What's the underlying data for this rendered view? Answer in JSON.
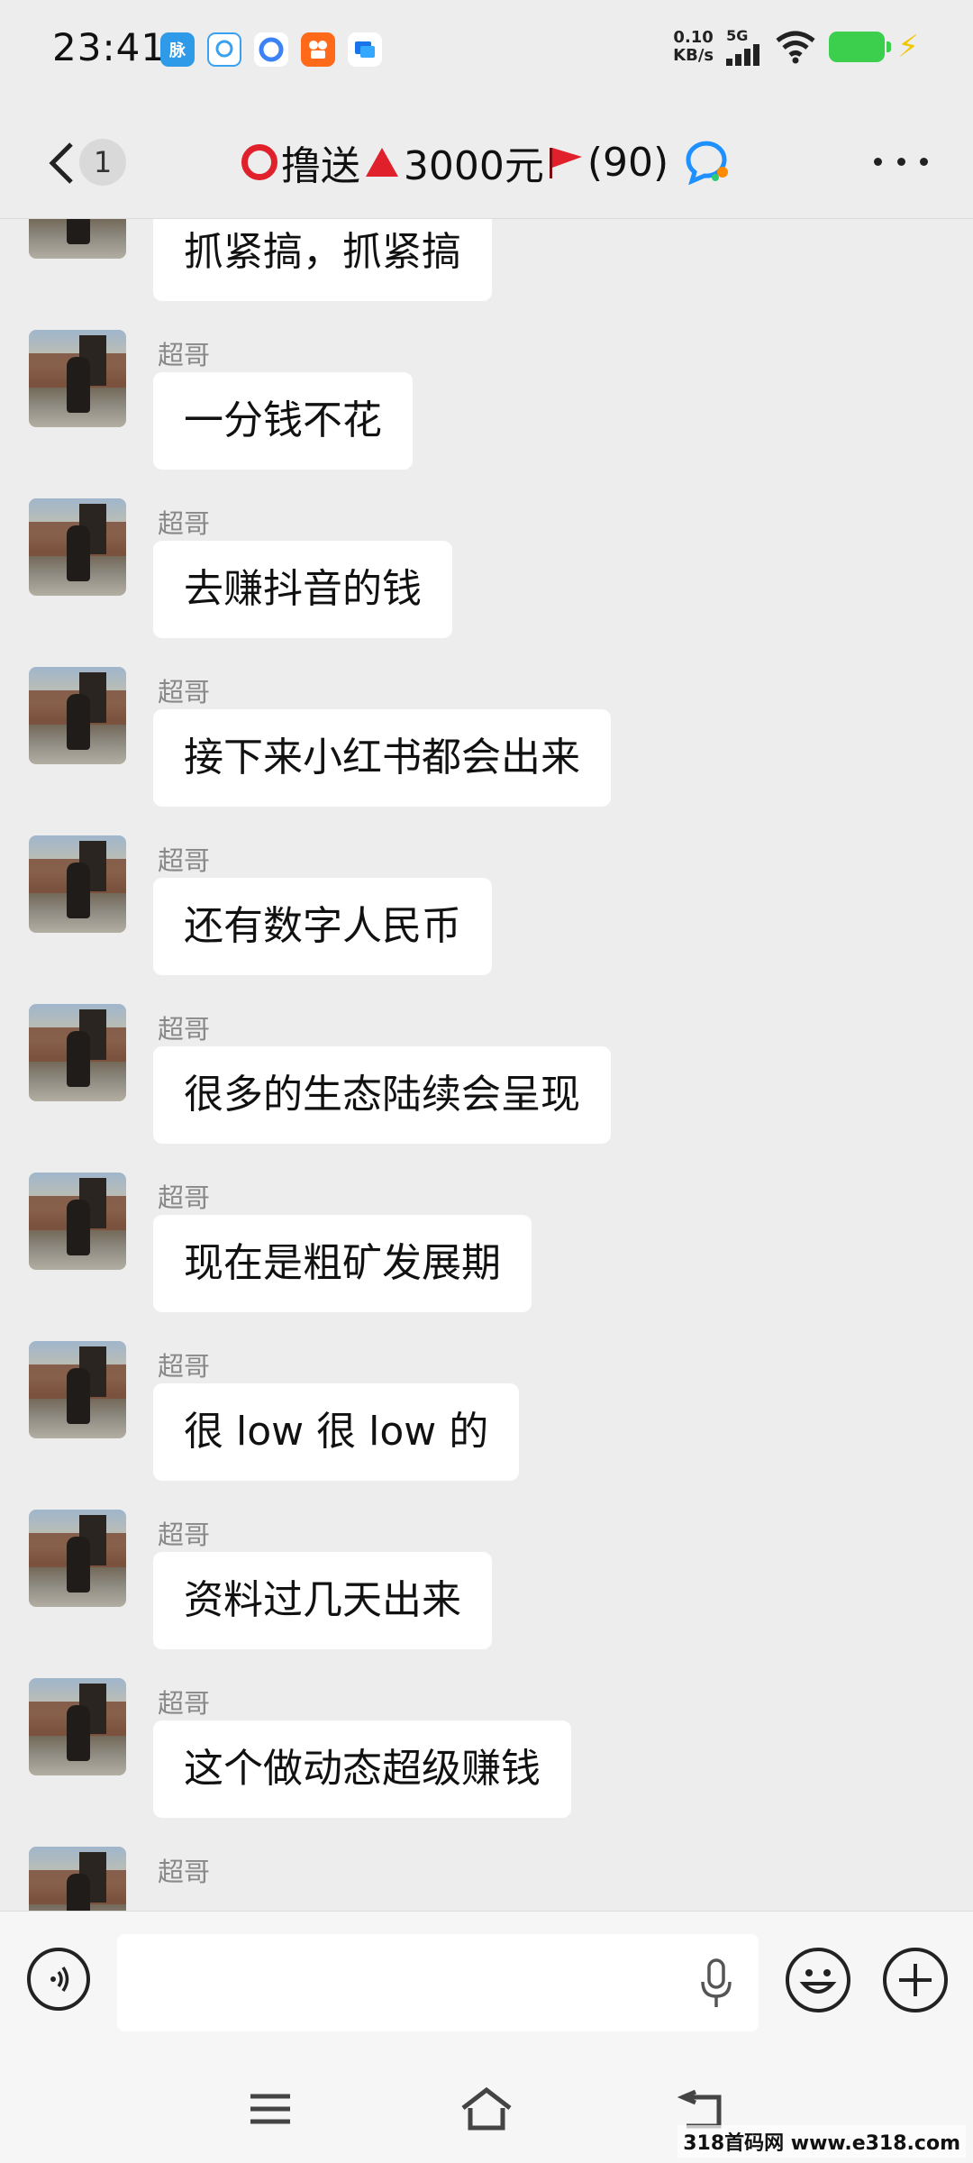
{
  "status": {
    "time": "23:41",
    "net_speed": "0.10",
    "net_unit": "KB/s",
    "network": "5G",
    "app_icons": [
      "脉",
      "chat-bubble-app-icon",
      "quark-browser-icon",
      "kuaishou-icon",
      "message-app-icon"
    ]
  },
  "header": {
    "back_count": "1",
    "title_text": "撸送",
    "title_amount": "3000元",
    "member_count": "(90)"
  },
  "messages": [
    {
      "sender": "超哥",
      "text": "抓紧搞，抓紧搞"
    },
    {
      "sender": "超哥",
      "text": "一分钱不花"
    },
    {
      "sender": "超哥",
      "text": "去赚抖音的钱"
    },
    {
      "sender": "超哥",
      "text": "接下来小红书都会出来"
    },
    {
      "sender": "超哥",
      "text": "还有数字人民币"
    },
    {
      "sender": "超哥",
      "text": "很多的生态陆续会呈现"
    },
    {
      "sender": "超哥",
      "text": "现在是粗矿发展期"
    },
    {
      "sender": "超哥",
      "text": "很 low 很 low 的"
    },
    {
      "sender": "超哥",
      "text": "资料过几天出来"
    },
    {
      "sender": "超哥",
      "text": "这个做动态超级赚钱"
    },
    {
      "sender": "超哥",
      "text": ""
    }
  ],
  "input": {
    "value": ""
  },
  "watermark": "318首码网 www.e318.com"
}
